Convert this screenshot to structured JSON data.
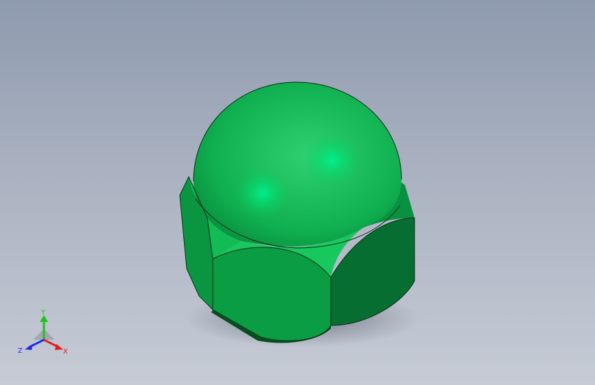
{
  "viewport": {
    "background_top": "#8e9aae",
    "background_bottom": "#c6cbd5"
  },
  "model": {
    "name": "acorn-cap-nut-icon",
    "body_color": "#07a143",
    "highlight_color": "#00f090"
  },
  "triad": {
    "x_label": "X",
    "y_label": "Y",
    "z_label": "Z",
    "x_color": "#e02020",
    "y_color": "#20c020",
    "z_color": "#2030e0"
  }
}
